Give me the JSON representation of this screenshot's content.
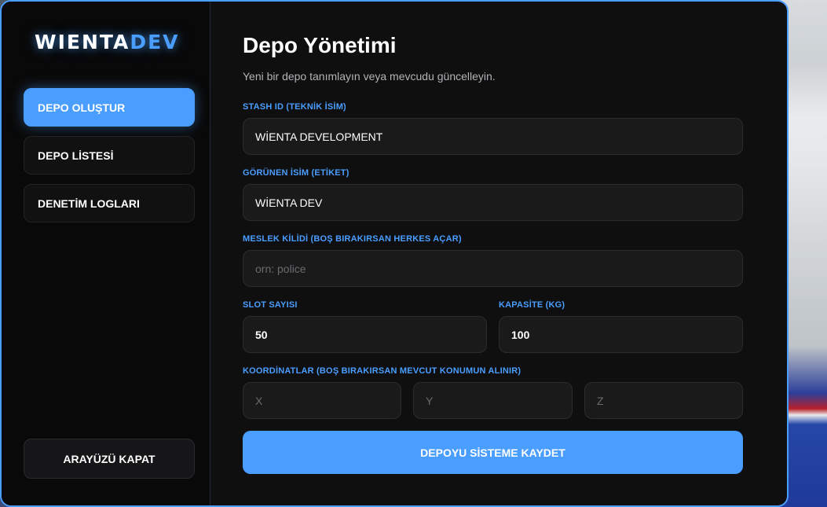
{
  "brand": {
    "part1": "WIENTA",
    "part2": "DEV",
    "accent_color": "#4a9eff"
  },
  "sidebar": {
    "items": [
      {
        "label": "DEPO OLUŞTUR",
        "active": true
      },
      {
        "label": "DEPO LİSTESİ",
        "active": false
      },
      {
        "label": "DENETİM LOGLARI",
        "active": false
      }
    ],
    "close_label": "ARAYÜZÜ KAPAT"
  },
  "main": {
    "title": "Depo Yönetimi",
    "subtitle": "Yeni bir depo tanımlayın veya mevcudu güncelleyin.",
    "fields": {
      "stash_id": {
        "label": "STASH ID (TEKNİK İSİM)",
        "value": "WİENTA DEVELOPMENT"
      },
      "display_name": {
        "label": "GÖRÜNEN İSİM (ETİKET)",
        "value": "WİENTA DEV"
      },
      "job_lock": {
        "label": "MESLEK KİLİDİ (BOŞ BIRAKIRSAN HERKES AÇAR)",
        "value": "",
        "placeholder": "orn: police"
      },
      "slots": {
        "label": "SLOT SAYISI",
        "value": "50"
      },
      "capacity": {
        "label": "KAPASİTE (KG)",
        "value": "100"
      },
      "coords": {
        "label": "KOORDİNATLAR (BOŞ BIRAKIRSAN MEVCUT KONUMUN ALINIR)",
        "x_placeholder": "X",
        "y_placeholder": "Y",
        "z_placeholder": "Z"
      }
    },
    "save_label": "DEPOYU SİSTEME KAYDET"
  }
}
